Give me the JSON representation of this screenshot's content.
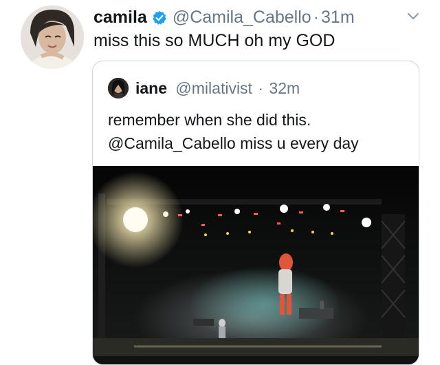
{
  "tweet": {
    "author_name": "camila",
    "handle": "@Camila_Cabello",
    "separator": "·",
    "time": "31m",
    "text": "miss this so MUCH oh my GOD"
  },
  "quoted_tweet": {
    "author_name": "iane",
    "handle": "@milativist",
    "separator": "·",
    "time": "32m",
    "text_line1": "remember when she did this.",
    "text_line2": "@Camila_Cabello miss u every day"
  },
  "icons": {
    "verified": "verified-badge-icon",
    "menu": "chevron-down-icon"
  },
  "colors": {
    "verified_blue": "#1da1f2",
    "secondary_text": "#657786",
    "primary_text": "#14171a",
    "border": "#ccd6dd"
  }
}
